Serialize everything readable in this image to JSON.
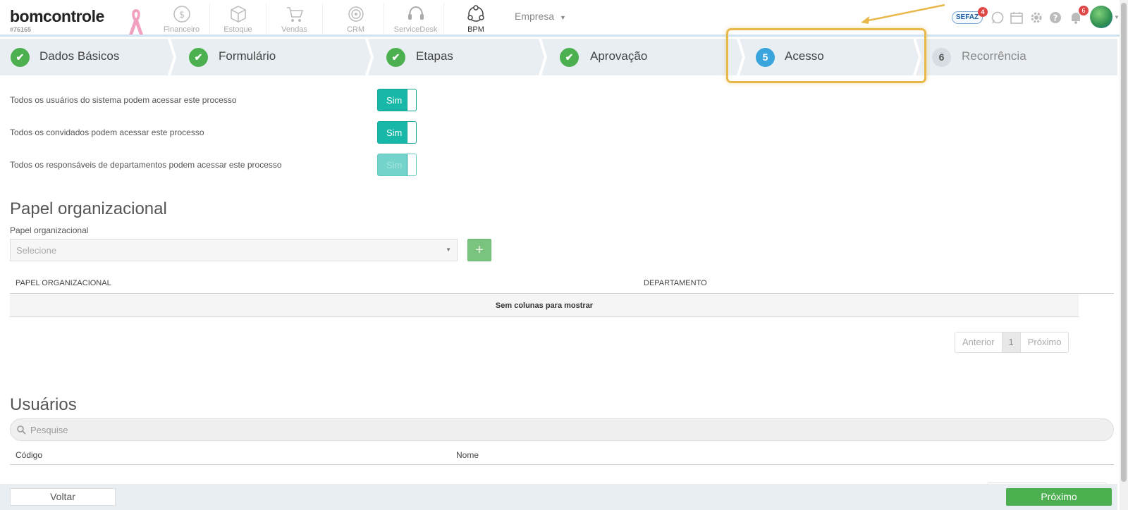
{
  "brand": {
    "logo": "bomcontrole",
    "account_id": "#76165"
  },
  "modules": [
    {
      "label": "Financeiro",
      "icon": "dollar-circle-icon"
    },
    {
      "label": "Estoque",
      "icon": "box-icon"
    },
    {
      "label": "Vendas",
      "icon": "cart-icon"
    },
    {
      "label": "CRM",
      "icon": "target-icon"
    },
    {
      "label": "ServiceDesk",
      "icon": "headset-icon"
    },
    {
      "label": "BPM",
      "icon": "network-icon"
    }
  ],
  "company_select": {
    "label": "Empresa",
    "caret": "▼"
  },
  "top_badges": {
    "sefaz_label": "SEFAZ",
    "sefaz_count": "4",
    "notifications_count": "6"
  },
  "steps": [
    {
      "number": "",
      "label": "Dados Básicos",
      "state": "done"
    },
    {
      "number": "",
      "label": "Formulário",
      "state": "done"
    },
    {
      "number": "",
      "label": "Etapas",
      "state": "done"
    },
    {
      "number": "",
      "label": "Aprovação",
      "state": "done"
    },
    {
      "number": "5",
      "label": "Acesso",
      "state": "current"
    },
    {
      "number": "6",
      "label": "Recorrência",
      "state": "todo"
    }
  ],
  "permissions": [
    {
      "label": "Todos os usuários do sistema podem acessar este processo",
      "value": "Sim",
      "disabled": false
    },
    {
      "label": "Todos os convidados podem acessar este processo",
      "value": "Sim",
      "disabled": false
    },
    {
      "label": "Todos os responsáveis de departamentos podem acessar este processo",
      "value": "Sim",
      "disabled": true
    }
  ],
  "papel_section": {
    "title": "Papel organizacional",
    "field_label": "Papel organizacional",
    "select_placeholder": "Selecione",
    "add_label": "+",
    "columns": [
      "PAPEL ORGANIZACIONAL",
      "DEPARTAMENTO"
    ],
    "empty_text": "Sem colunas para mostrar",
    "pagination": {
      "prev": "Anterior",
      "current": "1",
      "next": "Próximo"
    }
  },
  "usuarios_section": {
    "title": "Usuários",
    "search_placeholder": "Pesquise",
    "columns": [
      "Código",
      "Nome"
    ]
  },
  "footer": {
    "back_label": "Voltar",
    "next_label": "Próximo"
  },
  "colors": {
    "accent": "#17b8a8",
    "success": "#4caf50",
    "current_step": "#3aa5dc",
    "highlight": "#e8b84a"
  }
}
